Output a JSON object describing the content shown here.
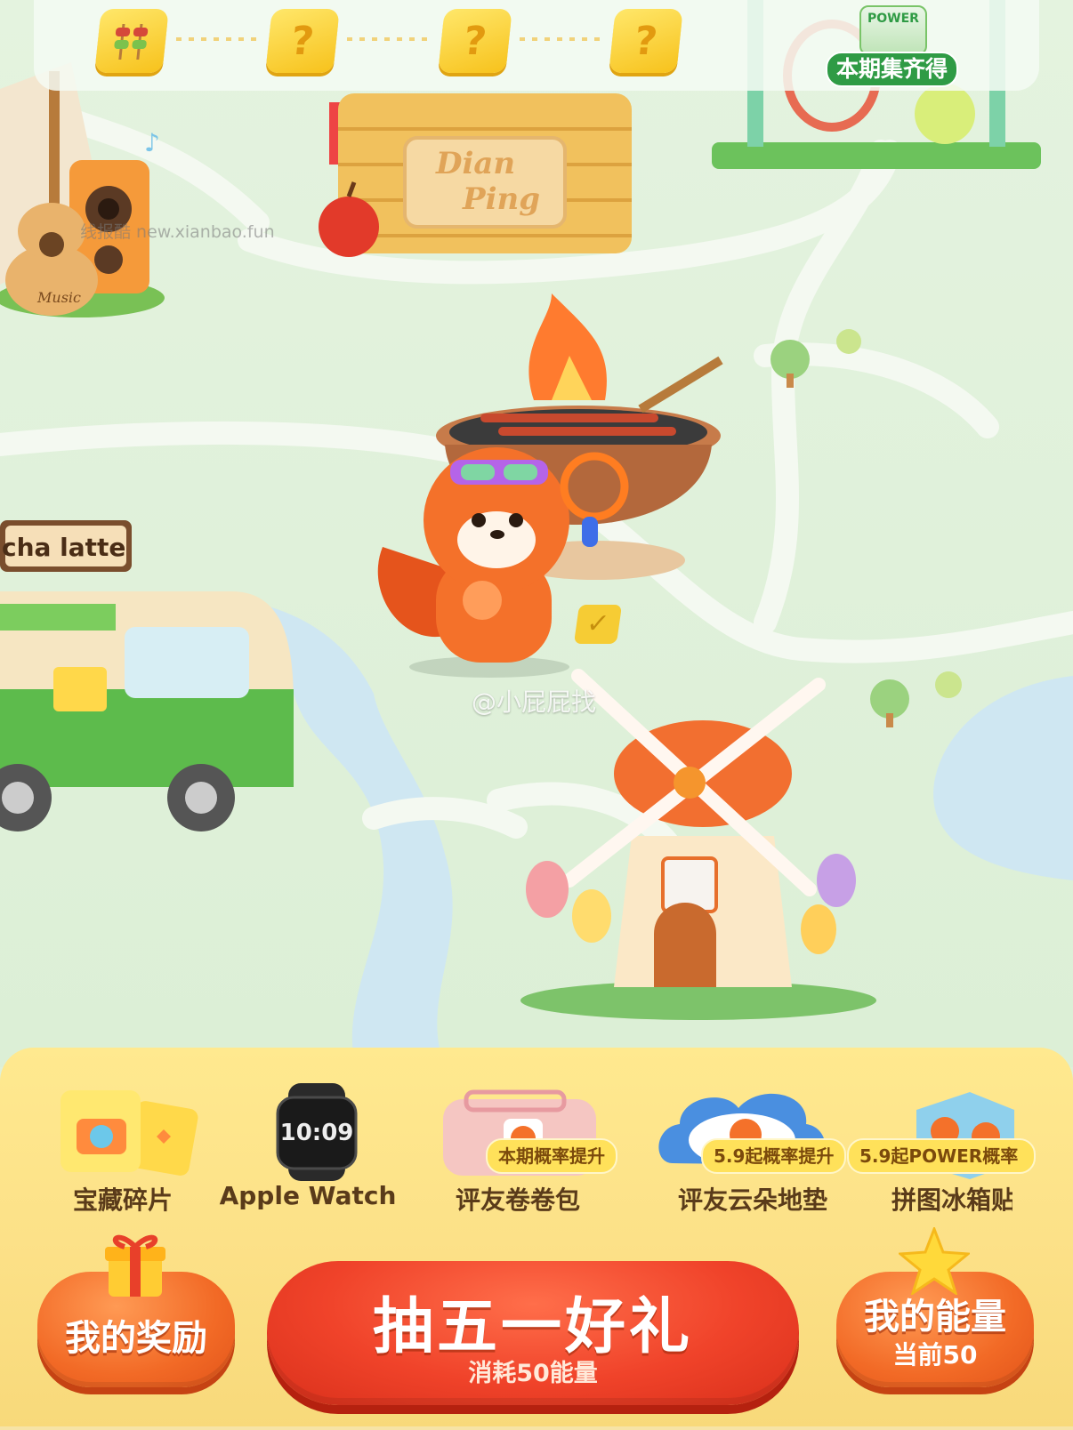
{
  "progress": {
    "slot_mark": "?",
    "goal_label": "本期集齐得",
    "goal_badge_text": "POWER",
    "collected_count": 1,
    "total_slots": 4
  },
  "map": {
    "music_sign": "Music",
    "basket_sign_line1": "Dian",
    "basket_sign_line2": "Ping",
    "truck_sign": "cha latte",
    "watermark_top": "线报酷 new.xianbao.fun",
    "watermark_mid": "@小屁屁找"
  },
  "prizes": [
    {
      "label": "宝藏碎片",
      "tag": ""
    },
    {
      "label": "Apple Watch",
      "tag": ""
    },
    {
      "label": "评友卷卷包",
      "tag": "本期概率提升"
    },
    {
      "label": "评友云朵地垫",
      "tag": "5.9起概率提升"
    },
    {
      "label": "拼图冰箱贴",
      "tag": "5.9起POWER概率"
    }
  ],
  "apple_watch_time": "10:09",
  "buttons": {
    "rewards": "我的奖励",
    "draw_title": "抽五一好礼",
    "draw_sub": "消耗50能量",
    "energy_title": "我的能量",
    "energy_sub": "当前50"
  },
  "colors": {
    "map_bg": "#dff0d9",
    "road": "#f3f8ef",
    "water": "#cde8f3",
    "panel": "#fce188",
    "draw_button": "#f0432a",
    "side_button": "#f26a26",
    "goal_badge": "#2f9b45"
  }
}
